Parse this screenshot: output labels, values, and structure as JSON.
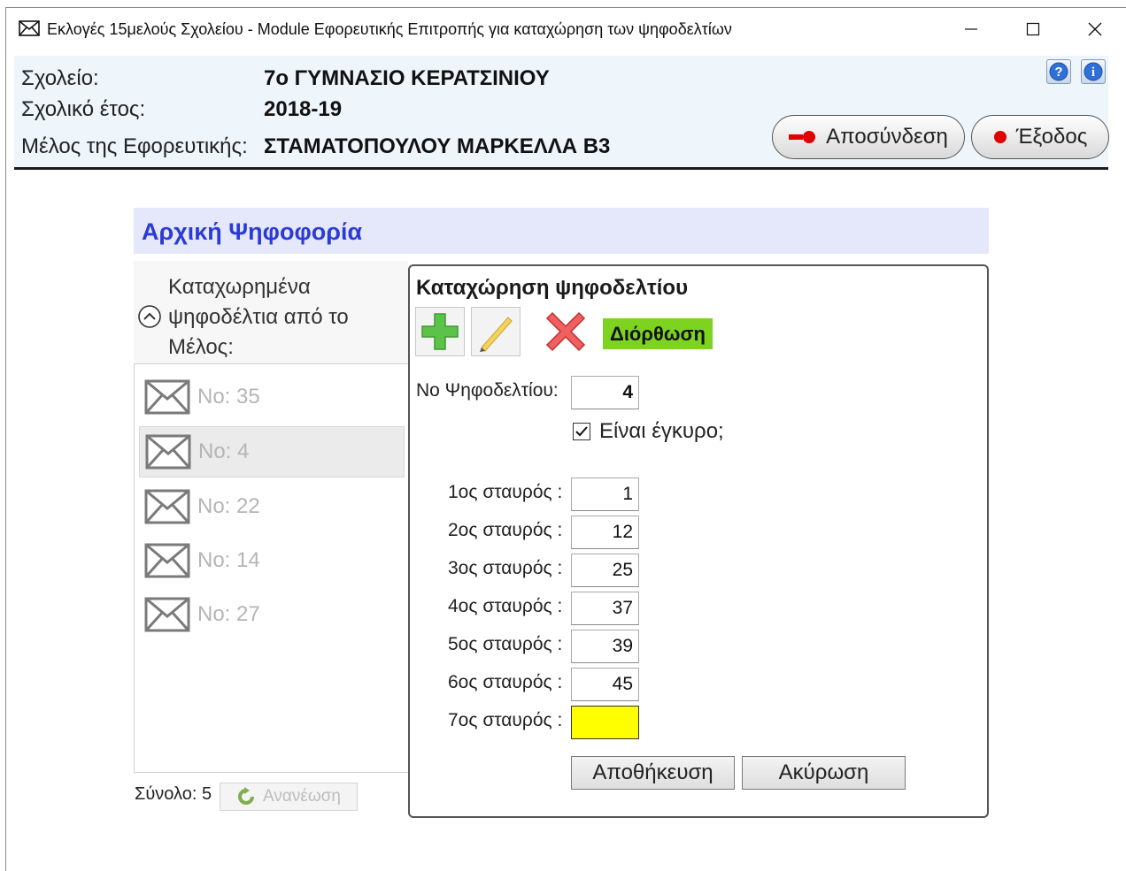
{
  "window": {
    "title": "Εκλογές 15μελούς Σχολείου - Module Εφορευτικής Επιτροπής για καταχώρηση των ψηφοδελτίων"
  },
  "header": {
    "school_label": "Σχολείο:",
    "school_value": "7ο ΓΥΜΝΑΣΙΟ ΚΕΡΑΤΣΙΝΙΟΥ",
    "year_label": "Σχολικό έτος:",
    "year_value": "2018-19",
    "member_label": "Μέλος της Εφορευτικής:",
    "member_value": "ΣΤΑΜΑΤΟΠΟΥΛΟΥ ΜΑΡΚΕΛΛΑ Β3",
    "disconnect_label": "Αποσύνδεση",
    "exit_label": "Έξοδος"
  },
  "section": {
    "title": "Αρχική Ψηφοφορία"
  },
  "ballot_list": {
    "heading": "Καταχωρημένα ψηφοδέλτια από το Μέλος:",
    "items": [
      {
        "label": "No:  35"
      },
      {
        "label": "No:  4"
      },
      {
        "label": "No:  22"
      },
      {
        "label": "No:  14"
      },
      {
        "label": "No:  27"
      }
    ],
    "selected_index": 1,
    "total": "Σύνολο: 5",
    "refresh_label": "Ανανέωση"
  },
  "form": {
    "title": "Καταχώρηση ψηφοδελτίου",
    "mode_badge": "Διόρθωση",
    "ballot_no_label": "Νο Ψηφοδελτίου:",
    "ballot_no_value": "4",
    "valid_label": "Είναι έγκυρο;",
    "valid_checked": true,
    "crosses": [
      {
        "label": "1ος σταυρός :",
        "value": "1"
      },
      {
        "label": "2ος σταυρός :",
        "value": "12"
      },
      {
        "label": "3ος σταυρός :",
        "value": "25"
      },
      {
        "label": "4ος σταυρός :",
        "value": "37"
      },
      {
        "label": "5ος σταυρός :",
        "value": "39"
      },
      {
        "label": "6ος σταυρός :",
        "value": "45"
      },
      {
        "label": "7ος σταυρός :",
        "value": ""
      }
    ],
    "save_label": "Αποθήκευση",
    "cancel_label": "Ακύρωση"
  },
  "colors": {
    "section_title": "#2c3bd6",
    "mode_badge": "#7ed321",
    "active_input": "#ffff00",
    "header_bg": "#eef5fb"
  }
}
